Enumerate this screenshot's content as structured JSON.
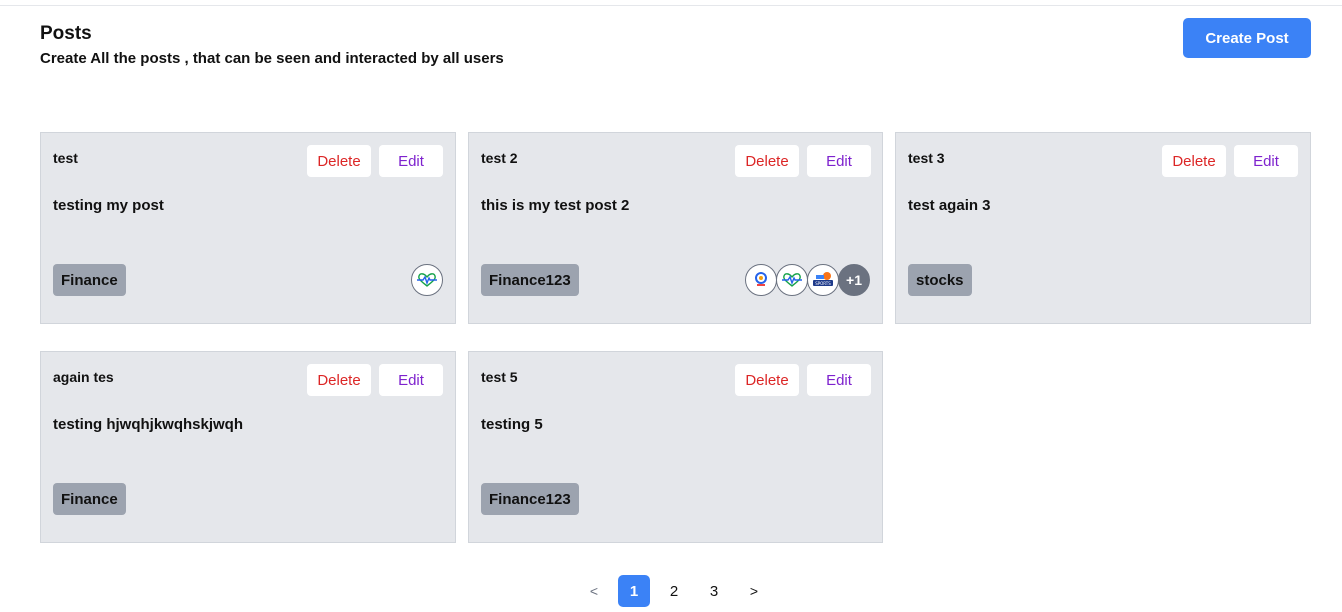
{
  "header": {
    "title": "Posts",
    "subtitle": "Create All the posts , that can be seen and interacted by all users",
    "create_label": "Create Post"
  },
  "actions": {
    "delete_label": "Delete",
    "edit_label": "Edit"
  },
  "posts": [
    {
      "title": "test",
      "body": "testing my post",
      "tag": "Finance",
      "avatars": [
        "heart-pulse-icon"
      ],
      "more": ""
    },
    {
      "title": "test 2",
      "body": "this is my test post 2",
      "tag": "Finance123",
      "avatars": [
        "pin-logo-icon",
        "heart-pulse-icon",
        "sports-logo-icon"
      ],
      "more": "+1"
    },
    {
      "title": "test 3",
      "body": "test again 3",
      "tag": "stocks",
      "avatars": [],
      "more": ""
    },
    {
      "title": "again tes",
      "body": "testing hjwqhjkwqhskjwqh",
      "tag": "Finance",
      "avatars": [],
      "more": ""
    },
    {
      "title": "test 5",
      "body": "testing 5",
      "tag": "Finance123",
      "avatars": [],
      "more": ""
    }
  ],
  "pagination": {
    "prev": "<",
    "pages": [
      "1",
      "2",
      "3"
    ],
    "current": "1",
    "next": ">"
  },
  "colors": {
    "accent": "#3b82f6",
    "delete": "#dc2626",
    "edit": "#7e22ce",
    "card_bg": "#e5e7eb",
    "tag_bg": "#9ca3af"
  }
}
